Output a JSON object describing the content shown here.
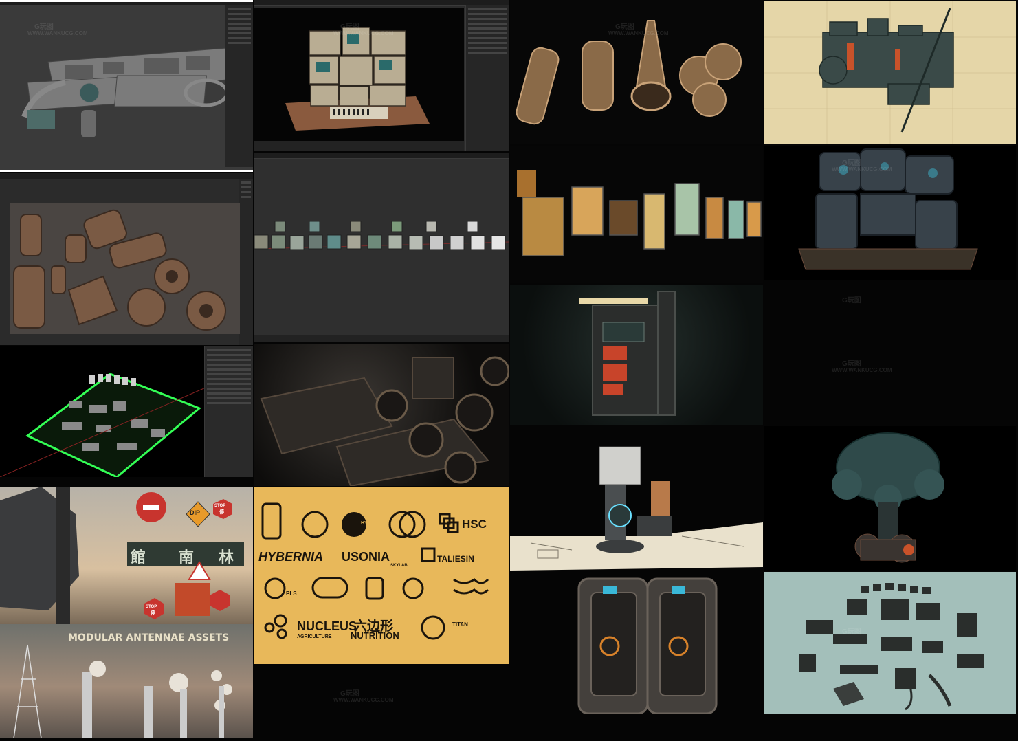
{
  "tiles": {
    "t1": {
      "kind": "blender-viewport",
      "subject": "modular sci-fi floor panels"
    },
    "t2": {
      "kind": "blender-viewport",
      "subject": "stacked retro electronics"
    },
    "t3": {
      "kind": "blender-viewport",
      "subject": "rusty industrial pipe parts"
    },
    "t4": {
      "kind": "blender-viewport",
      "subject": "row of material cubes"
    },
    "t5": {
      "kind": "blender-viewport",
      "subject": "kitbash library on green grid"
    },
    "t6": {
      "kind": "render",
      "subject": "dark mechanical closeup"
    },
    "t7": {
      "kind": "render",
      "subject": "street signs",
      "signs": [
        "DIP",
        "STOP",
        "停",
        "館",
        "南",
        "林",
        "STOP",
        "停"
      ]
    },
    "t8": {
      "kind": "logo-sheet",
      "logos": [
        "HYBERNIA",
        "HSC",
        "HYBERNIA",
        "USONIA",
        "SKYLAB",
        "TALIESIN",
        "PLS",
        "NUCLEUS",
        "AGRICULTURE",
        "六边形",
        "NUTRITION",
        "TITAN"
      ]
    },
    "t9": {
      "kind": "render",
      "subject": "modular antennae",
      "title": "MODULAR ANTENNAE ASSETS"
    },
    "t10": {
      "kind": "render",
      "subject": "rocket engines"
    },
    "t11": {
      "kind": "render",
      "subject": "sci-fi screens and posters"
    },
    "t12": {
      "kind": "render",
      "subject": "arcade machine"
    },
    "t13": {
      "kind": "render",
      "subject": "mech chair on blueprint"
    },
    "t14": {
      "kind": "render",
      "subject": "sci-fi doors"
    },
    "t15": {
      "kind": "render",
      "subject": "spaceship on blueprint paper"
    },
    "t16": {
      "kind": "render",
      "subject": "mech structure"
    },
    "t17": {
      "kind": "render",
      "subject": "mushroom tree structure"
    },
    "t18": {
      "kind": "render",
      "subject": "exploded kitbash parts"
    }
  },
  "watermark": {
    "logo": "G玩图",
    "site": "WWW.WANKUCG.COM"
  },
  "colors": {
    "blender_bg": "#2b2b2b",
    "green_grid": "#33ff55",
    "paper": "#e5d6a8",
    "logo_bg": "#e8b85a",
    "teal": "#a3bfba"
  }
}
